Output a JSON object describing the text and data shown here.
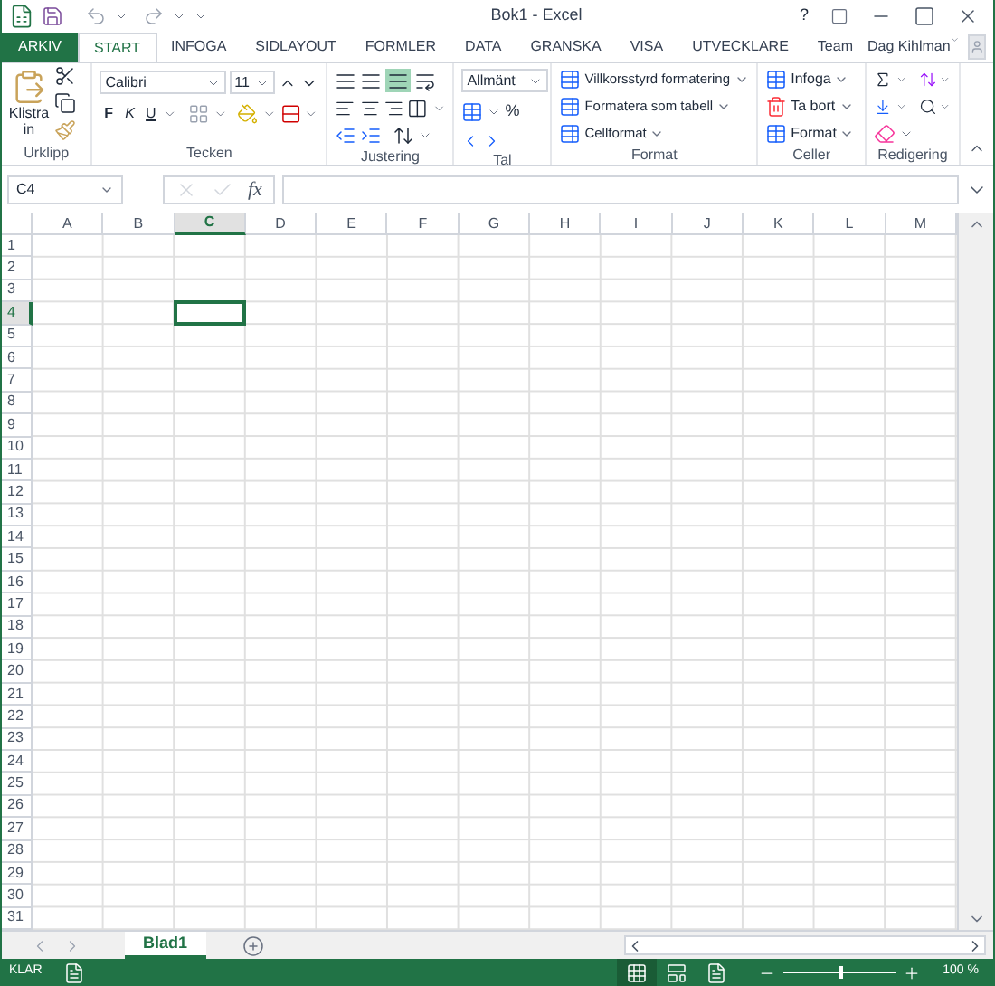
{
  "window": {
    "title": "Bok1 - Excel",
    "help": "?"
  },
  "file_tab": "ARKIV",
  "tabs": [
    {
      "label": "START",
      "selected": true
    },
    {
      "label": "INFOGA",
      "selected": false
    },
    {
      "label": "SIDLAYOUT",
      "selected": false
    },
    {
      "label": "FORMLER",
      "selected": false
    },
    {
      "label": "DATA",
      "selected": false
    },
    {
      "label": "GRANSKA",
      "selected": false
    },
    {
      "label": "VISA",
      "selected": false
    },
    {
      "label": "UTVECKLARE",
      "selected": false
    },
    {
      "label": "Team",
      "selected": false
    }
  ],
  "user": "Dag Kihlman",
  "ribbon": {
    "clipboard": {
      "label": "Urklipp",
      "paste": "Klistra in"
    },
    "font": {
      "label": "Tecken",
      "font_name": "Calibri",
      "font_size": "11",
      "bold": "F",
      "italic": "K",
      "underline": "U"
    },
    "alignment": {
      "label": "Justering",
      "middle_align_on": true
    },
    "number": {
      "label": "Tal",
      "format": "Allmänt",
      "percent": "%"
    },
    "styles": {
      "label": "Format",
      "items": [
        "Villkorsstyrd formatering",
        "Formatera som tabell",
        "Cellformat"
      ]
    },
    "cells": {
      "label": "Celler",
      "items": [
        "Infoga",
        "Ta bort",
        "Format"
      ]
    },
    "editing": {
      "label": "Redigering"
    }
  },
  "formula_bar": {
    "name_box": "C4",
    "fx": "fx"
  },
  "columns": [
    {
      "label": "A",
      "selected": false
    },
    {
      "label": "B",
      "selected": false
    },
    {
      "label": "C",
      "selected": true
    },
    {
      "label": "D",
      "selected": false
    },
    {
      "label": "E",
      "selected": false
    },
    {
      "label": "F",
      "selected": false
    },
    {
      "label": "G",
      "selected": false
    },
    {
      "label": "H",
      "selected": false
    },
    {
      "label": "I",
      "selected": false
    },
    {
      "label": "J",
      "selected": false
    },
    {
      "label": "K",
      "selected": false
    },
    {
      "label": "L",
      "selected": false
    },
    {
      "label": "M",
      "selected": false
    }
  ],
  "rows": [
    {
      "label": "1",
      "selected": false
    },
    {
      "label": "2",
      "selected": false
    },
    {
      "label": "3",
      "selected": false
    },
    {
      "label": "4",
      "selected": true
    },
    {
      "label": "5",
      "selected": false
    },
    {
      "label": "6",
      "selected": false
    },
    {
      "label": "7",
      "selected": false
    },
    {
      "label": "8",
      "selected": false
    },
    {
      "label": "9",
      "selected": false
    },
    {
      "label": "10",
      "selected": false
    },
    {
      "label": "11",
      "selected": false
    },
    {
      "label": "12",
      "selected": false
    },
    {
      "label": "13",
      "selected": false
    },
    {
      "label": "14",
      "selected": false
    },
    {
      "label": "15",
      "selected": false
    },
    {
      "label": "16",
      "selected": false
    },
    {
      "label": "17",
      "selected": false
    },
    {
      "label": "18",
      "selected": false
    },
    {
      "label": "19",
      "selected": false
    },
    {
      "label": "20",
      "selected": false
    },
    {
      "label": "21",
      "selected": false
    },
    {
      "label": "22",
      "selected": false
    },
    {
      "label": "23",
      "selected": false
    },
    {
      "label": "24",
      "selected": false
    },
    {
      "label": "25",
      "selected": false
    },
    {
      "label": "26",
      "selected": false
    },
    {
      "label": "27",
      "selected": false
    },
    {
      "label": "28",
      "selected": false
    },
    {
      "label": "29",
      "selected": false
    },
    {
      "label": "30",
      "selected": false
    },
    {
      "label": "31",
      "selected": false
    }
  ],
  "sheet_tabs": [
    {
      "label": "Blad1",
      "selected": true
    }
  ],
  "status": {
    "text": "KLAR",
    "zoom": "100 %",
    "zoom_slider": {
      "level": 0.5
    },
    "views": [
      {
        "kind": "normal",
        "selected": true
      },
      {
        "kind": "page_layout",
        "selected": false
      },
      {
        "kind": "page_break",
        "selected": false
      }
    ]
  }
}
